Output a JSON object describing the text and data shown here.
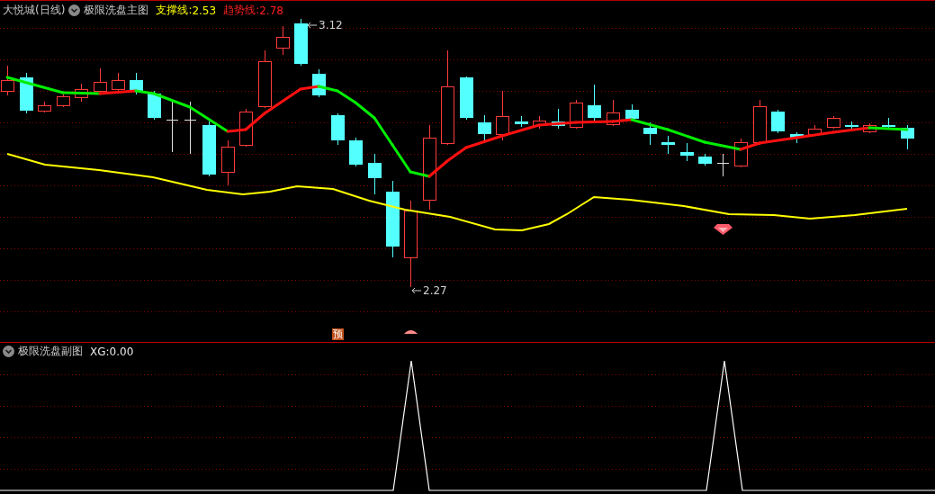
{
  "main_panel": {
    "stock_name": "大悦城(日线)",
    "indicator_title": "极限洗盘主图",
    "legend": [
      {
        "kind": "support",
        "label": "支撑线:",
        "value": "2.53"
      },
      {
        "kind": "trend",
        "label": "趋势线:",
        "value": "2.78"
      }
    ],
    "price_labels": [
      {
        "kind": "high",
        "text": "3.12"
      },
      {
        "kind": "low",
        "text": "2.27"
      }
    ],
    "signal_badge": "预"
  },
  "sub_panel": {
    "indicator_title": "极限洗盘副图",
    "readout": {
      "label": "XG:",
      "value": "0.00"
    }
  }
}
